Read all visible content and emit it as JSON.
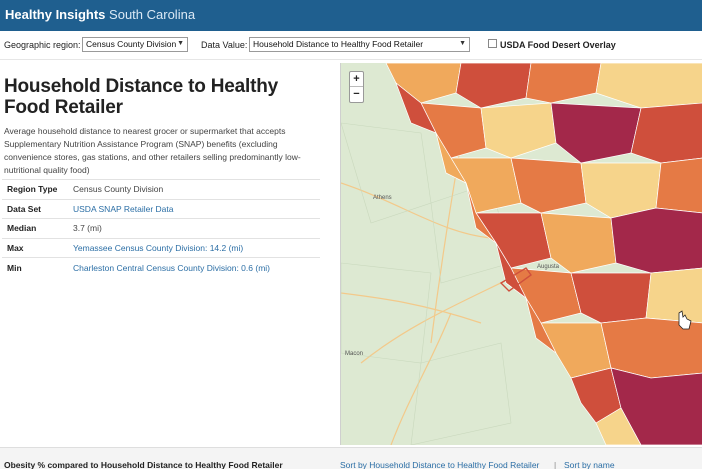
{
  "app": {
    "brand_main": "Healthy Insights",
    "brand_sub": "South Carolina"
  },
  "controls": {
    "region_label": "Geographic region:",
    "region_value": "Census County Division",
    "data_label": "Data Value:",
    "data_value": "Household Distance to Healthy Food Retailer",
    "overlay_label": "USDA Food Desert Overlay",
    "overlay_checked": false
  },
  "panel": {
    "title": "Household Distance to Healthy Food Retailer",
    "description": "Average household distance to nearest grocer or supermarket that accepts Supplementary Nutrition Assistance Program (SNAP) benefits (excluding convenience stores, gas stations, and other retailers selling predominantly low-nutritional quality food)",
    "rows": [
      {
        "key": "Region Type",
        "value": "Census County Division",
        "link": false
      },
      {
        "key": "Data Set",
        "value": "USDA SNAP Retailer Data",
        "link": true
      },
      {
        "key": "Median",
        "value": "3.7 (mi)",
        "link": false
      },
      {
        "key": "Max",
        "value": "Yemassee Census County Division: 14.2 (mi)",
        "link": true
      },
      {
        "key": "Min",
        "value": "Charleston Central Census County Division: 0.6 (mi)",
        "link": true
      }
    ]
  },
  "map": {
    "zoom_in": "+",
    "zoom_out": "−",
    "place_labels": [
      "Athens",
      "Augusta",
      "Macon"
    ],
    "colors": {
      "light": "#f6d48b",
      "mid_light": "#f0a95c",
      "mid": "#e57a45",
      "dark": "#cf4f3c",
      "darkest": "#a3284a",
      "base_land": "#dbe8cf"
    }
  },
  "bottom": {
    "chart_title": "Obesity % compared to Household Distance to Healthy Food Retailer",
    "sort_by_value": "Sort by Household Distance to Healthy Food Retailer",
    "sort_by_name": "Sort by name",
    "separator": "|"
  }
}
